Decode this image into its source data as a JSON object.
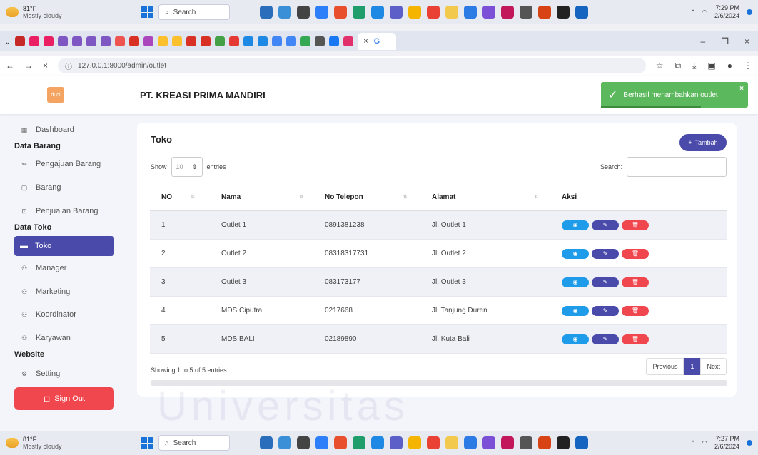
{
  "taskbar_top": {
    "temp": "81°F",
    "weather": "Mostly cloudy",
    "search": "Search",
    "time": "7:29 PM",
    "date": "2/6/2024"
  },
  "taskbar_bottom": {
    "temp": "81°F",
    "weather": "Mostly cloudy",
    "search": "Search",
    "time": "7:27 PM",
    "date": "2/6/2024"
  },
  "browser": {
    "url": "127.0.0.1:8000/admin/outlet"
  },
  "header": {
    "logo_text": "duol",
    "company": "PT. KREASI PRIMA MANDIRI"
  },
  "toast": {
    "message": "Berhasil menambahkan outlet"
  },
  "sidebar": {
    "dashboard": "Dashboard",
    "section_barang": "Data Barang",
    "pengajuan": "Pengajuan Barang",
    "barang": "Barang",
    "penjualan": "Penjualan Barang",
    "section_toko": "Data Toko",
    "toko": "Toko",
    "manager": "Manager",
    "marketing": "Marketing",
    "koordinator": "Koordinator",
    "karyawan": "Karyawan",
    "section_website": "Website",
    "setting": "Setting",
    "signout": "Sign Out"
  },
  "card": {
    "title": "Toko",
    "add_button": "Tambah",
    "show_label": "Show",
    "entries_value": "10",
    "entries_label": "entries",
    "search_label": "Search:",
    "columns": {
      "no": "NO",
      "nama": "Nama",
      "tel": "No Telepon",
      "alamat": "Alamat",
      "aksi": "Aksi"
    },
    "rows": [
      {
        "no": "1",
        "nama": "Outlet 1",
        "tel": "0891381238",
        "alamat": "Jl. Outlet 1"
      },
      {
        "no": "2",
        "nama": "Outlet 2",
        "tel": "08318317731",
        "alamat": "Jl. Outlet 2"
      },
      {
        "no": "3",
        "nama": "Outlet 3",
        "tel": "083173177",
        "alamat": "Jl. Outlet 3"
      },
      {
        "no": "4",
        "nama": "MDS Ciputra",
        "tel": "0217668",
        "alamat": "Jl. Tanjung Duren"
      },
      {
        "no": "5",
        "nama": "MDS BALI",
        "tel": "02189890",
        "alamat": "Jl. Kuta Bali"
      }
    ],
    "info": "Showing 1 to 5 of 5 entries",
    "prev": "Previous",
    "page": "1",
    "next": "Next"
  },
  "watermark": "Universitas"
}
